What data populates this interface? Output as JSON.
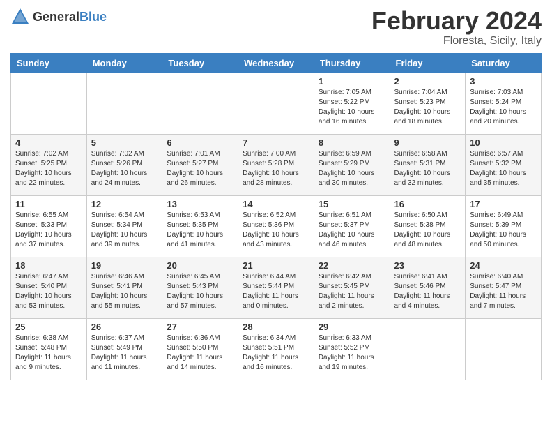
{
  "header": {
    "logo_general": "General",
    "logo_blue": "Blue",
    "month_year": "February 2024",
    "location": "Floresta, Sicily, Italy"
  },
  "days_of_week": [
    "Sunday",
    "Monday",
    "Tuesday",
    "Wednesday",
    "Thursday",
    "Friday",
    "Saturday"
  ],
  "weeks": [
    [
      {
        "day": "",
        "info": ""
      },
      {
        "day": "",
        "info": ""
      },
      {
        "day": "",
        "info": ""
      },
      {
        "day": "",
        "info": ""
      },
      {
        "day": "1",
        "info": "Sunrise: 7:05 AM\nSunset: 5:22 PM\nDaylight: 10 hours\nand 16 minutes."
      },
      {
        "day": "2",
        "info": "Sunrise: 7:04 AM\nSunset: 5:23 PM\nDaylight: 10 hours\nand 18 minutes."
      },
      {
        "day": "3",
        "info": "Sunrise: 7:03 AM\nSunset: 5:24 PM\nDaylight: 10 hours\nand 20 minutes."
      }
    ],
    [
      {
        "day": "4",
        "info": "Sunrise: 7:02 AM\nSunset: 5:25 PM\nDaylight: 10 hours\nand 22 minutes."
      },
      {
        "day": "5",
        "info": "Sunrise: 7:02 AM\nSunset: 5:26 PM\nDaylight: 10 hours\nand 24 minutes."
      },
      {
        "day": "6",
        "info": "Sunrise: 7:01 AM\nSunset: 5:27 PM\nDaylight: 10 hours\nand 26 minutes."
      },
      {
        "day": "7",
        "info": "Sunrise: 7:00 AM\nSunset: 5:28 PM\nDaylight: 10 hours\nand 28 minutes."
      },
      {
        "day": "8",
        "info": "Sunrise: 6:59 AM\nSunset: 5:29 PM\nDaylight: 10 hours\nand 30 minutes."
      },
      {
        "day": "9",
        "info": "Sunrise: 6:58 AM\nSunset: 5:31 PM\nDaylight: 10 hours\nand 32 minutes."
      },
      {
        "day": "10",
        "info": "Sunrise: 6:57 AM\nSunset: 5:32 PM\nDaylight: 10 hours\nand 35 minutes."
      }
    ],
    [
      {
        "day": "11",
        "info": "Sunrise: 6:55 AM\nSunset: 5:33 PM\nDaylight: 10 hours\nand 37 minutes."
      },
      {
        "day": "12",
        "info": "Sunrise: 6:54 AM\nSunset: 5:34 PM\nDaylight: 10 hours\nand 39 minutes."
      },
      {
        "day": "13",
        "info": "Sunrise: 6:53 AM\nSunset: 5:35 PM\nDaylight: 10 hours\nand 41 minutes."
      },
      {
        "day": "14",
        "info": "Sunrise: 6:52 AM\nSunset: 5:36 PM\nDaylight: 10 hours\nand 43 minutes."
      },
      {
        "day": "15",
        "info": "Sunrise: 6:51 AM\nSunset: 5:37 PM\nDaylight: 10 hours\nand 46 minutes."
      },
      {
        "day": "16",
        "info": "Sunrise: 6:50 AM\nSunset: 5:38 PM\nDaylight: 10 hours\nand 48 minutes."
      },
      {
        "day": "17",
        "info": "Sunrise: 6:49 AM\nSunset: 5:39 PM\nDaylight: 10 hours\nand 50 minutes."
      }
    ],
    [
      {
        "day": "18",
        "info": "Sunrise: 6:47 AM\nSunset: 5:40 PM\nDaylight: 10 hours\nand 53 minutes."
      },
      {
        "day": "19",
        "info": "Sunrise: 6:46 AM\nSunset: 5:41 PM\nDaylight: 10 hours\nand 55 minutes."
      },
      {
        "day": "20",
        "info": "Sunrise: 6:45 AM\nSunset: 5:43 PM\nDaylight: 10 hours\nand 57 minutes."
      },
      {
        "day": "21",
        "info": "Sunrise: 6:44 AM\nSunset: 5:44 PM\nDaylight: 11 hours\nand 0 minutes."
      },
      {
        "day": "22",
        "info": "Sunrise: 6:42 AM\nSunset: 5:45 PM\nDaylight: 11 hours\nand 2 minutes."
      },
      {
        "day": "23",
        "info": "Sunrise: 6:41 AM\nSunset: 5:46 PM\nDaylight: 11 hours\nand 4 minutes."
      },
      {
        "day": "24",
        "info": "Sunrise: 6:40 AM\nSunset: 5:47 PM\nDaylight: 11 hours\nand 7 minutes."
      }
    ],
    [
      {
        "day": "25",
        "info": "Sunrise: 6:38 AM\nSunset: 5:48 PM\nDaylight: 11 hours\nand 9 minutes."
      },
      {
        "day": "26",
        "info": "Sunrise: 6:37 AM\nSunset: 5:49 PM\nDaylight: 11 hours\nand 11 minutes."
      },
      {
        "day": "27",
        "info": "Sunrise: 6:36 AM\nSunset: 5:50 PM\nDaylight: 11 hours\nand 14 minutes."
      },
      {
        "day": "28",
        "info": "Sunrise: 6:34 AM\nSunset: 5:51 PM\nDaylight: 11 hours\nand 16 minutes."
      },
      {
        "day": "29",
        "info": "Sunrise: 6:33 AM\nSunset: 5:52 PM\nDaylight: 11 hours\nand 19 minutes."
      },
      {
        "day": "",
        "info": ""
      },
      {
        "day": "",
        "info": ""
      }
    ]
  ]
}
